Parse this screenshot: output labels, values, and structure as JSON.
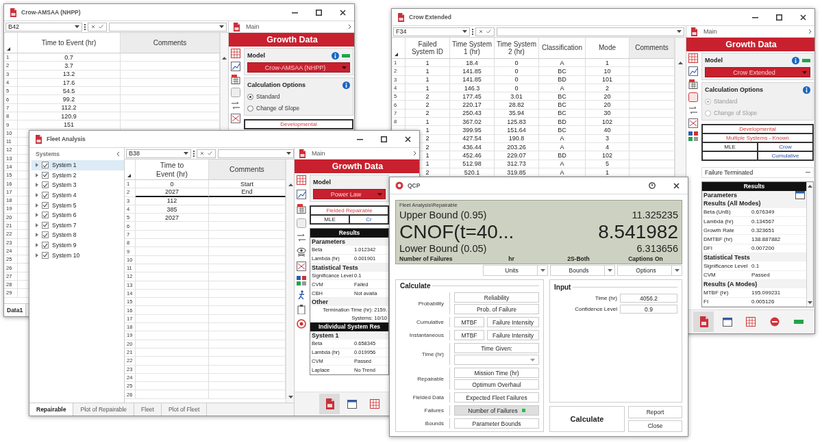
{
  "crow_amsaa": {
    "title": "Crow-AMSAA (NHPP)",
    "cell_ref": "B42",
    "columns": [
      "Time to Event (hr)",
      "Comments"
    ],
    "rows": [
      {
        "row": "1",
        "time": "0.7"
      },
      {
        "row": "2",
        "time": "3.7"
      },
      {
        "row": "3",
        "time": "13.2"
      },
      {
        "row": "4",
        "time": "17.6"
      },
      {
        "row": "5",
        "time": "54.5"
      },
      {
        "row": "6",
        "time": "99.2"
      },
      {
        "row": "7",
        "time": "112.2"
      },
      {
        "row": "8",
        "time": "120.9"
      },
      {
        "row": "9",
        "time": "151"
      }
    ],
    "more_rows": [
      "10",
      "11",
      "12",
      "13",
      "14",
      "15",
      "16",
      "17",
      "18",
      "19",
      "20",
      "21",
      "22",
      "23",
      "24",
      "25",
      "26",
      "27",
      "28",
      "29"
    ],
    "sheet_tabs": [
      {
        "label": "Data1",
        "selected": true
      }
    ],
    "panel": {
      "header": "Main",
      "title": "Growth Data",
      "model_label": "Model",
      "model": "Crow-AMSAA (NHPP)",
      "options_label": "Calculation Options",
      "options_disabled": false,
      "options": [
        {
          "label": "Standard",
          "selected": true
        },
        {
          "label": "Change of Slope",
          "selected": false
        }
      ],
      "settings": [
        [
          {
            "kind": "title",
            "text": "Developmental"
          }
        ]
      ]
    }
  },
  "crow_extended": {
    "title": "Crow Extended",
    "cell_ref": "F34",
    "columns": [
      "Failed System ID",
      "Time System 1 (hr)",
      "Time System 2 (hr)",
      "Classification",
      "Mode",
      "Comments"
    ],
    "rows": [
      {
        "row": "1",
        "cells": [
          "1",
          "18.4",
          "0",
          "A",
          "1"
        ]
      },
      {
        "row": "2",
        "cells": [
          "1",
          "141.85",
          "0",
          "BC",
          "10"
        ]
      },
      {
        "row": "3",
        "cells": [
          "1",
          "141.85",
          "0",
          "BD",
          "101"
        ]
      },
      {
        "row": "4",
        "cells": [
          "1",
          "146.3",
          "0",
          "A",
          "2"
        ]
      },
      {
        "row": "5",
        "cells": [
          "2",
          "177.45",
          "3.01",
          "BC",
          "20"
        ]
      },
      {
        "row": "6",
        "cells": [
          "2",
          "220.17",
          "28.82",
          "BC",
          "20"
        ]
      },
      {
        "row": "7",
        "cells": [
          "2",
          "250.43",
          "35.94",
          "BC",
          "30"
        ]
      },
      {
        "row": "8",
        "cells": [
          "1",
          "367.02",
          "125.83",
          "BD",
          "102"
        ]
      },
      {
        "cells": [
          "1",
          "399.95",
          "151.64",
          "BC",
          "40"
        ]
      },
      {
        "cells": [
          "2",
          "427.54",
          "190.8",
          "A",
          "3"
        ]
      },
      {
        "cells": [
          "2",
          "436.44",
          "203.26",
          "A",
          "4"
        ]
      },
      {
        "cells": [
          "1",
          "452.46",
          "229.07",
          "BD",
          "102"
        ]
      },
      {
        "cells": [
          "1",
          "512.98",
          "312.73",
          "A",
          "5"
        ]
      },
      {
        "cells": [
          "2",
          "520.1",
          "319.85",
          "A",
          "1"
        ]
      }
    ],
    "panel": {
      "header": "Main",
      "title": "Growth Data",
      "model_label": "Model",
      "model": "Crow Extended",
      "options_label": "Calculation Options",
      "options_disabled": true,
      "options": [
        {
          "label": "Standard",
          "selected": true
        },
        {
          "label": "Change of Slope",
          "selected": false
        }
      ],
      "settings": [
        [
          {
            "kind": "title",
            "text": "Developmental"
          }
        ],
        [
          {
            "kind": "title",
            "text": "Multiple Systems - Known"
          }
        ],
        [
          {
            "kind": "method",
            "text": "MLE"
          },
          {
            "kind": "choice",
            "text": "Crow"
          }
        ],
        [
          {
            "kind": "blank"
          },
          {
            "kind": "choice",
            "text": "Cumulative"
          }
        ]
      ],
      "termination": "Failure Terminated",
      "results": [
        {
          "kind": "header",
          "text": "Results"
        },
        {
          "kind": "section",
          "text": "Parameters"
        },
        {
          "kind": "section",
          "text": "Results (All Modes)"
        },
        {
          "kind": "pair",
          "label": "Beta (UnB)",
          "value": "0.676349"
        },
        {
          "kind": "pair",
          "label": "Lambda (hr)",
          "value": "0.134567"
        },
        {
          "kind": "pair",
          "label": "Growth Rate",
          "value": "0.323651"
        },
        {
          "kind": "pair",
          "label": "DMTBF (hr)",
          "value": "138.887882"
        },
        {
          "kind": "pair",
          "label": "DFI",
          "value": "0.007200"
        },
        {
          "kind": "section",
          "text": "Statistical Tests"
        },
        {
          "kind": "pair",
          "label": "Significance Level",
          "value": "0.1"
        },
        {
          "kind": "pair",
          "label": "CVM",
          "value": "Passed"
        },
        {
          "kind": "section",
          "text": "Results (A Modes)"
        },
        {
          "kind": "pair",
          "label": "MTBF (hr)",
          "value": "195.099231"
        },
        {
          "kind": "pair",
          "label": "FI",
          "value": "0.005126"
        }
      ]
    }
  },
  "fleet_analysis": {
    "title": "Fleet Analysis",
    "systems_label": "Systems",
    "systems": [
      {
        "label": "System 1",
        "checked": true,
        "selected": true
      },
      {
        "label": "System 2",
        "checked": true,
        "selected": false
      },
      {
        "label": "System 3",
        "checked": true,
        "selected": false
      },
      {
        "label": "System 4",
        "checked": true,
        "selected": false
      },
      {
        "label": "System 5",
        "checked": true,
        "selected": false
      },
      {
        "label": "System 6",
        "checked": true,
        "selected": false
      },
      {
        "label": "System 7",
        "checked": true,
        "selected": false
      },
      {
        "label": "System 8",
        "checked": true,
        "selected": false
      },
      {
        "label": "System 9",
        "checked": true,
        "selected": false
      },
      {
        "label": "System 10",
        "checked": true,
        "selected": false
      }
    ],
    "cell_ref": "B38",
    "columns": [
      "Time to Event (hr)",
      "Comments"
    ],
    "rows": [
      {
        "row": "1",
        "time": "0",
        "comment": "Start",
        "boundary": false
      },
      {
        "row": "2",
        "time": "2027",
        "comment": "End",
        "boundary": true
      },
      {
        "row": "3",
        "time": "112",
        "boundary": false
      },
      {
        "row": "4",
        "time": "385",
        "boundary": false
      },
      {
        "row": "5",
        "time": "2027",
        "boundary": false
      }
    ],
    "more_rows": [
      "6",
      "7",
      "8",
      "9",
      "10",
      "11",
      "12",
      "13",
      "14",
      "15",
      "16",
      "17",
      "18",
      "19",
      "20",
      "21",
      "22",
      "23",
      "24",
      "25",
      "26"
    ],
    "tabs": [
      {
        "label": "Repairable",
        "selected": true
      },
      {
        "label": "Plot of Repairable",
        "selected": false
      },
      {
        "label": "Fleet",
        "selected": false
      },
      {
        "label": "Plot of Fleet",
        "selected": false
      }
    ],
    "panel": {
      "header": "Main",
      "title": "Growth Data",
      "model_label": "Model",
      "model": "Power Law",
      "settings": [
        [
          {
            "kind": "title",
            "text": "Fielded Repairable"
          }
        ],
        [
          {
            "kind": "method",
            "text": "MLE"
          },
          {
            "kind": "choice",
            "text": "Cr"
          }
        ]
      ],
      "results": [
        {
          "kind": "header",
          "text": "Results"
        },
        {
          "kind": "section",
          "text": "Parameters"
        },
        {
          "kind": "pair",
          "label": "Beta",
          "value": "1.012342"
        },
        {
          "kind": "pair",
          "label": "Lambda (hr)",
          "value": "0.001901"
        },
        {
          "kind": "section",
          "text": "Statistical Tests"
        },
        {
          "kind": "pair",
          "label": "Significance Level",
          "value": "0.1"
        },
        {
          "kind": "pair",
          "label": "CVM",
          "value": "Failed"
        },
        {
          "kind": "pair",
          "label": "CBH",
          "value": "Not availa"
        },
        {
          "kind": "section",
          "text": "Other"
        },
        {
          "kind": "note",
          "text": "Termination Time (hr): 2159."
        },
        {
          "kind": "note",
          "text": "Systems: 10/10"
        },
        {
          "kind": "header",
          "text": "Individual System Res"
        },
        {
          "kind": "section",
          "text": "System 1"
        },
        {
          "kind": "pair",
          "label": "Beta",
          "value": "0.658345"
        },
        {
          "kind": "pair",
          "label": "Lambda (hr)",
          "value": "0.019956"
        },
        {
          "kind": "pair",
          "label": "CVM",
          "value": "Passed"
        },
        {
          "kind": "pair",
          "label": "Laplace",
          "value": "No Trend"
        }
      ]
    }
  },
  "qcp": {
    "title": "QCP",
    "path": "Fleet Analysis\\Repairable",
    "upper_label": "Upper Bound (0.95)",
    "upper": "11.325235",
    "main_label": "CNOF(t=40...",
    "main": "8.541982",
    "lower_label": "Lower Bound (0.05)",
    "lower": "6.313656",
    "result_name": "Number of Failures",
    "settings": [
      {
        "value": "hr",
        "label": "Units"
      },
      {
        "value": "2S-Both",
        "label": "Bounds"
      },
      {
        "value": "Captions On",
        "label": "Options"
      }
    ],
    "calculate": {
      "title": "Calculate",
      "groups": [
        {
          "label": "Probability",
          "rows": [
            [
              {
                "kind": "button",
                "label": "Reliability",
                "selected": false
              }
            ],
            [
              {
                "kind": "button",
                "label": "Prob. of Failure",
                "selected": false
              }
            ]
          ]
        },
        {
          "label": "Cumulative",
          "rows": [
            [
              {
                "kind": "button",
                "label": "MTBF",
                "selected": false
              },
              {
                "kind": "button",
                "label": "Failure Intensity",
                "selected": false
              }
            ]
          ]
        },
        {
          "label": "Instantaneous",
          "rows": [
            [
              {
                "kind": "button",
                "label": "MTBF",
                "selected": false
              },
              {
                "kind": "button",
                "label": "Failure Intensity",
                "selected": false
              }
            ]
          ]
        },
        {
          "label": "Time (hr)",
          "rows": [
            [
              {
                "kind": "button",
                "label": "Time Given:",
                "selected": false
              }
            ],
            [
              {
                "kind": "dropdown"
              }
            ]
          ]
        },
        {
          "label": "Repairable",
          "rows": [
            [
              {
                "kind": "button",
                "label": "Mission Time (hr)",
                "selected": false
              }
            ],
            [
              {
                "kind": "button",
                "label": "Optimum Overhaul",
                "selected": false
              }
            ]
          ]
        },
        {
          "label": "Fielded Data",
          "rows": [
            [
              {
                "kind": "button",
                "label": "Expected Fleet Failures",
                "selected": false
              }
            ]
          ]
        },
        {
          "label": "Failures",
          "rows": [
            [
              {
                "kind": "button",
                "label": "Number of Failures",
                "selected": true
              }
            ]
          ]
        },
        {
          "label": "Bounds",
          "rows": [
            [
              {
                "kind": "button",
                "label": "Parameter Bounds",
                "selected": false
              }
            ]
          ]
        }
      ]
    },
    "input": {
      "title": "Input",
      "fields": [
        {
          "label": "Time (hr)",
          "value": "4056.2"
        },
        {
          "label": "Confidence Level",
          "value": "0.9"
        }
      ]
    },
    "buttons": [
      "Calculate",
      "Report",
      "Close"
    ]
  }
}
